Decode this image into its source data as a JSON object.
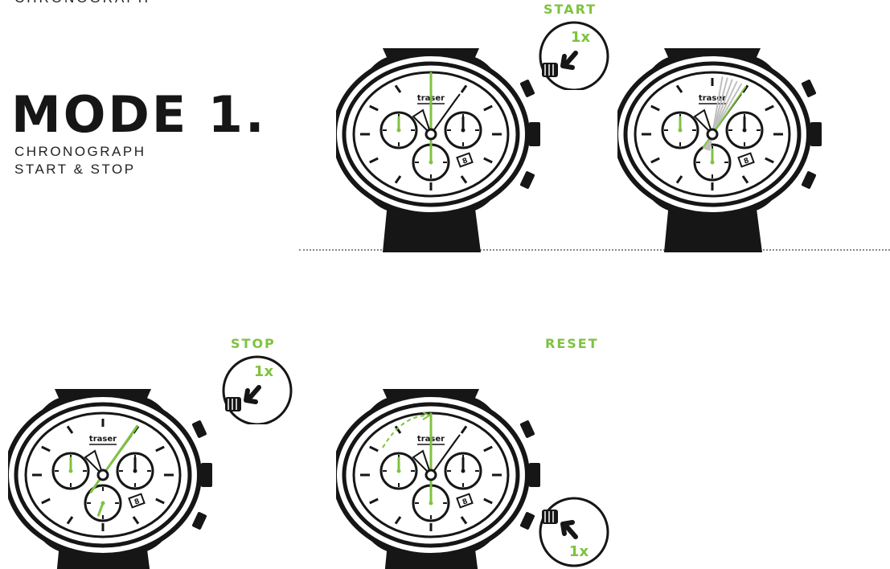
{
  "header": {
    "cut_title": "CHRONOGRAPH",
    "title": "MODE 1.",
    "subtitle_line1": "CHRONOGRAPH",
    "subtitle_line2": "START & STOP"
  },
  "steps": {
    "start": {
      "label": "START",
      "press": "1x"
    },
    "stop": {
      "label": "STOP",
      "press": "1x"
    },
    "reset": {
      "label": "RESET",
      "press": "1x"
    }
  },
  "watch": {
    "brand": "traser",
    "date": "8"
  },
  "colors": {
    "accent": "#7ec340",
    "ink": "#161616",
    "divider": "#8a8a8a"
  },
  "icons": [
    "watch-illustration",
    "crown-press-icon",
    "arrow-press-icon",
    "reset-arc-arrow-icon"
  ]
}
